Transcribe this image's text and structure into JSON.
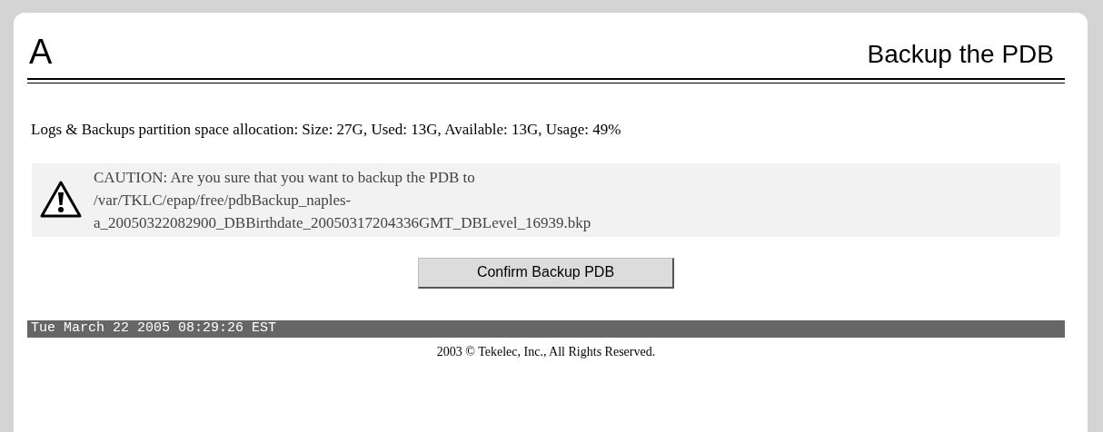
{
  "header": {
    "logo": "A",
    "title": "Backup the PDB"
  },
  "space_info": "Logs & Backups partition space allocation: Size: 27G, Used: 13G, Available: 13G, Usage: 49%",
  "caution": {
    "lines": [
      "CAUTION: Are you sure that you want to backup the PDB to",
      "/var/TKLC/epap/free/pdbBackup_naples-",
      "a_20050322082900_DBBirthdate_20050317204336GMT_DBLevel_16939.bkp"
    ]
  },
  "confirm_button": "Confirm Backup PDB",
  "status_bar": "Tue March 22 2005 08:29:26 EST",
  "footer": "2003 © Tekelec, Inc., All Rights Reserved."
}
